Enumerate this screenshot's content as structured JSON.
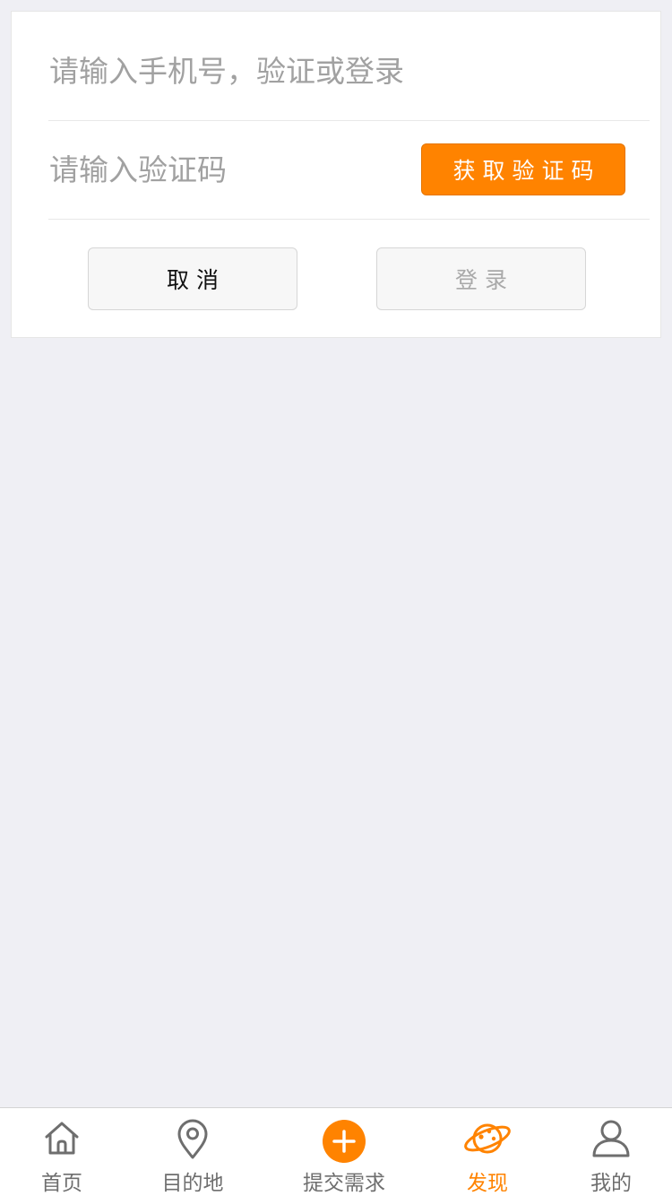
{
  "form": {
    "phone_placeholder": "请输入手机号，验证或登录",
    "code_placeholder": "请输入验证码",
    "get_code_label": "获取验证码",
    "cancel_label": "取消",
    "login_label": "登录"
  },
  "tab_bar": {
    "tabs": [
      {
        "label": "首页",
        "icon": "home-icon"
      },
      {
        "label": "目的地",
        "icon": "location-pin-icon"
      },
      {
        "label": "提交需求",
        "icon": "plus-circle-icon"
      },
      {
        "label": "发现",
        "icon": "planet-icon"
      },
      {
        "label": "我的",
        "icon": "user-icon"
      }
    ],
    "active_tab": "发现"
  },
  "colors": {
    "accent": "#ff8300",
    "background": "#efeff4",
    "inactive_tab": "#6e6e6e",
    "placeholder": "#a1a1a1"
  }
}
